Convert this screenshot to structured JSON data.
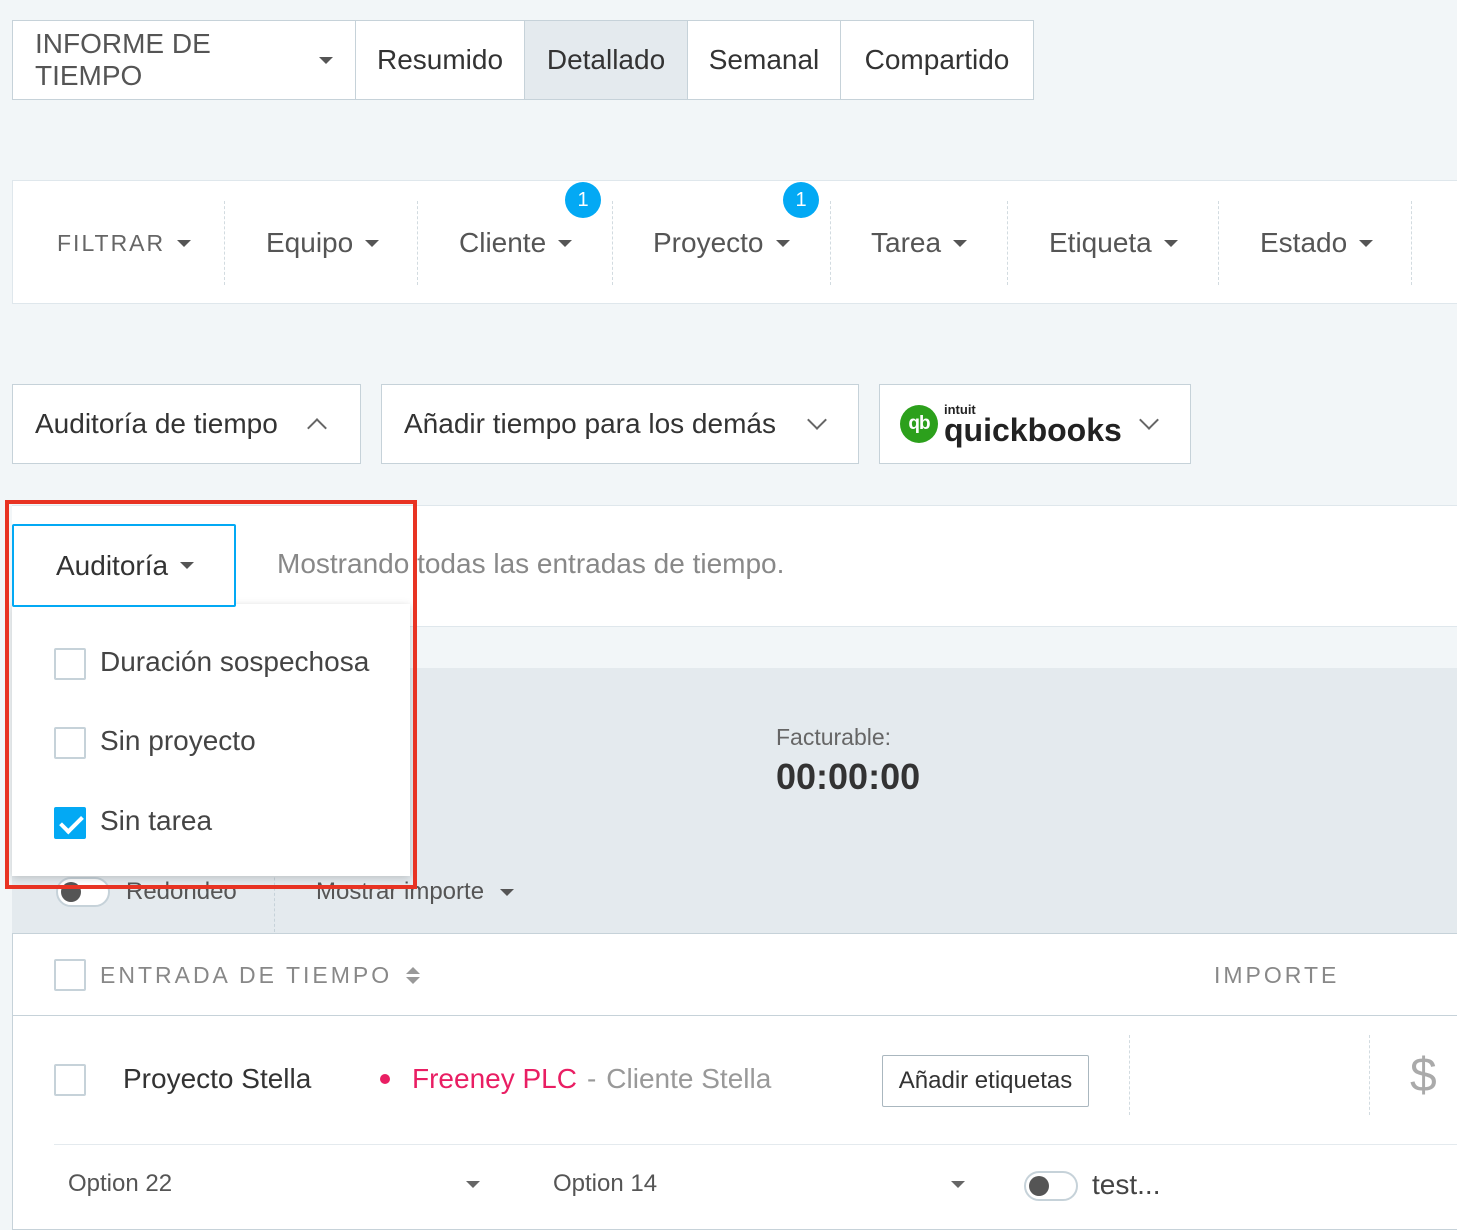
{
  "tabs": {
    "report": "INFORME DE TIEMPO",
    "items": [
      "Resumido",
      "Detallado",
      "Semanal",
      "Compartido"
    ],
    "active": "Detallado"
  },
  "filters": {
    "filter_label": "FILTRAR",
    "items": [
      "Equipo",
      "Cliente",
      "Proyecto",
      "Tarea",
      "Etiqueta",
      "Estado"
    ],
    "badges": {
      "Cliente": "1",
      "Proyecto": "1"
    }
  },
  "actions": {
    "audit_time": "Auditoría de tiempo",
    "add_time_others": "Añadir tiempo para los demás",
    "quickbooks": {
      "small": "intuit",
      "big": "quickbooks",
      "icon_text": "qb"
    }
  },
  "audit": {
    "button_label": "Auditoría",
    "message": "Mostrando todas las entradas de tiempo.",
    "options": [
      {
        "label": "Duración sospechosa",
        "checked": false
      },
      {
        "label": "Sin proyecto",
        "checked": false
      },
      {
        "label": "Sin tarea",
        "checked": true
      }
    ]
  },
  "summary": {
    "billable_label": "Facturable:",
    "billable_value": "00:00:00",
    "rounding_label": "Redondeo",
    "show_amount_label": "Mostrar importe"
  },
  "table": {
    "col_entry": "ENTRADA DE TIEMPO",
    "col_amount": "IMPORTE",
    "row": {
      "project": "Proyecto Stella",
      "client_project": "Freeney PLC",
      "separator": "-",
      "client": "Cliente Stella",
      "add_tags": "Añadir etiquetas",
      "currency": "$",
      "project_color": "#e91e63",
      "select1": "Option 22",
      "select2": "Option 14",
      "toggle_text": "test..."
    }
  },
  "colors": {
    "accent": "#03a9f4",
    "highlight_box": "#e83323",
    "quickbooks_green": "#2ca01c"
  }
}
